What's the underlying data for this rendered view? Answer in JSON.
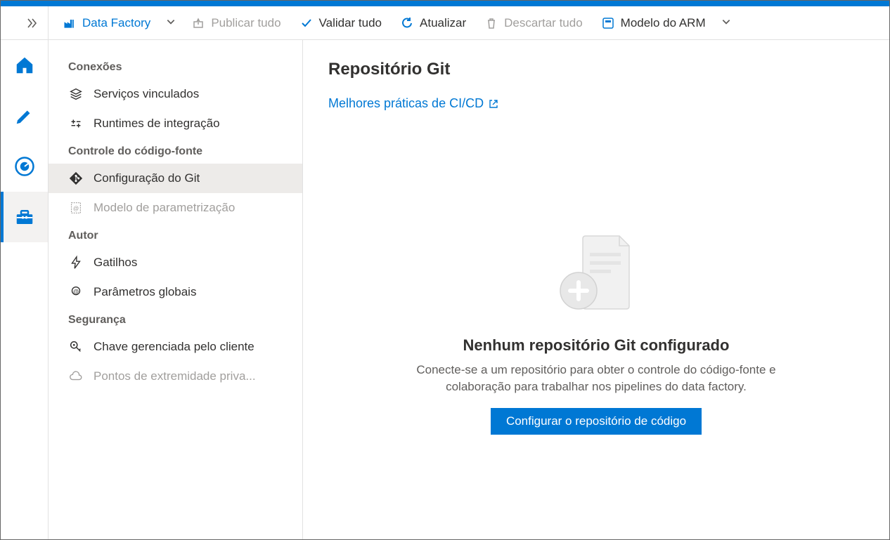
{
  "toolbar": {
    "data_factory_label": "Data Factory",
    "publish_all": "Publicar tudo",
    "validate_all": "Validar tudo",
    "refresh": "Atualizar",
    "discard_all": "Descartar tudo",
    "arm_template": "Modelo do ARM"
  },
  "sidebar": {
    "sections": {
      "connections": {
        "title": "Conexões",
        "linked_services": "Serviços vinculados",
        "integration_runtimes": "Runtimes de integração"
      },
      "source_control": {
        "title": "Controle do código-fonte",
        "git_config": "Configuração do Git",
        "param_template": "Modelo de parametrização"
      },
      "author": {
        "title": "Autor",
        "triggers": "Gatilhos",
        "global_params": "Parâmetros globais"
      },
      "security": {
        "title": "Segurança",
        "cmk": "Chave gerenciada pelo cliente",
        "private_endpoints": "Pontos de extremidade priva..."
      }
    }
  },
  "main": {
    "title": "Repositório Git",
    "best_practices_link": "Melhores práticas de CI/CD",
    "empty": {
      "title": "Nenhum repositório Git configurado",
      "description": "Conecte-se a um repositório para obter o controle do código-fonte e colaboração para trabalhar nos pipelines do data factory.",
      "button": "Configurar o repositório de código"
    }
  }
}
